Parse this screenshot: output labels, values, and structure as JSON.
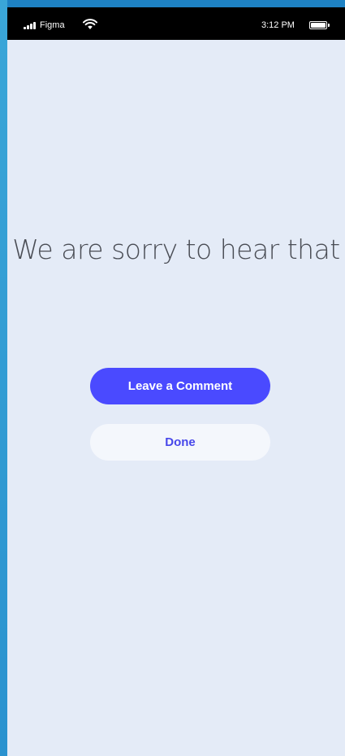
{
  "status_bar": {
    "carrier": "Figma",
    "time": "3:12 PM",
    "signal_icon": "signal-bars-icon",
    "wifi_icon": "wifi-icon",
    "battery_icon": "battery-icon",
    "battery_level": 1.0
  },
  "main": {
    "headline": "We are sorry to hear that",
    "primary_button_label": "Leave a Comment",
    "secondary_button_label": "Done"
  },
  "colors": {
    "background": "#e4ebf7",
    "primary": "#4a4aff",
    "primary_text": "#ffffff",
    "secondary_bg": "#f4f7fc",
    "secondary_text": "#4747ea",
    "headline_text": "#4a4d55",
    "frame": "#1f86c6",
    "status_bar": "#000000"
  }
}
